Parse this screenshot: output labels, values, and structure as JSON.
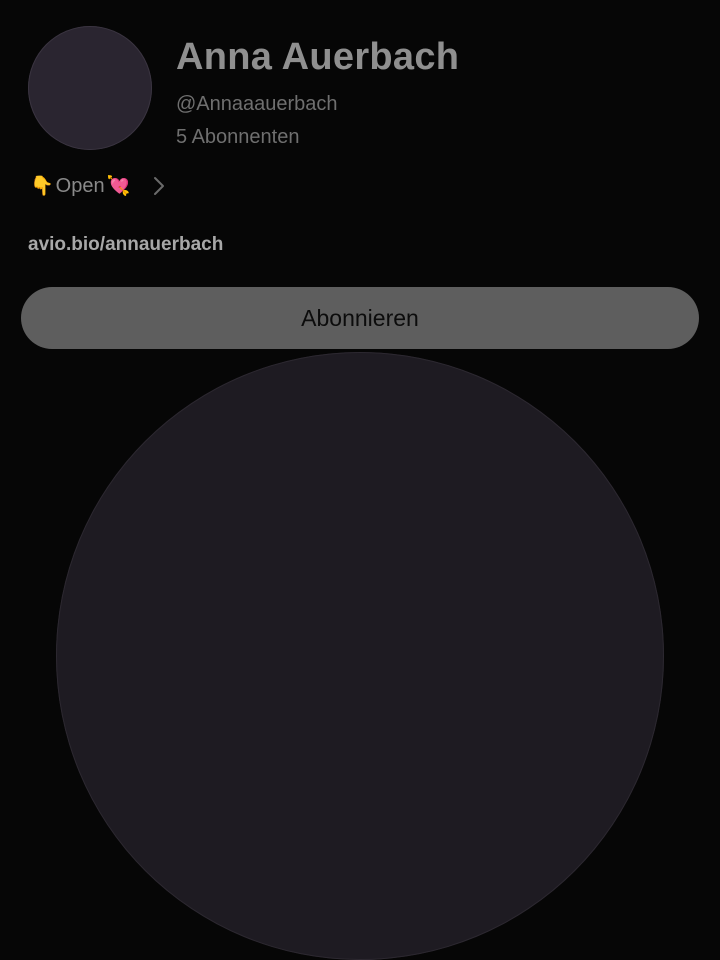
{
  "profile": {
    "name": "Anna Auerbach",
    "handle": "@Annaaauerbach",
    "subscribers": "5 Abonnenten",
    "teaser": {
      "left_emoji": "👇",
      "label": "Open",
      "right_emoji": "💘"
    },
    "link": "avio.bio/annauerbach"
  },
  "actions": {
    "subscribe_label": "Abonnieren"
  },
  "colors": {
    "background": "#060606",
    "button": "#5e5e5e",
    "name": "#8f8f8f",
    "muted": "#6f6f6f"
  }
}
